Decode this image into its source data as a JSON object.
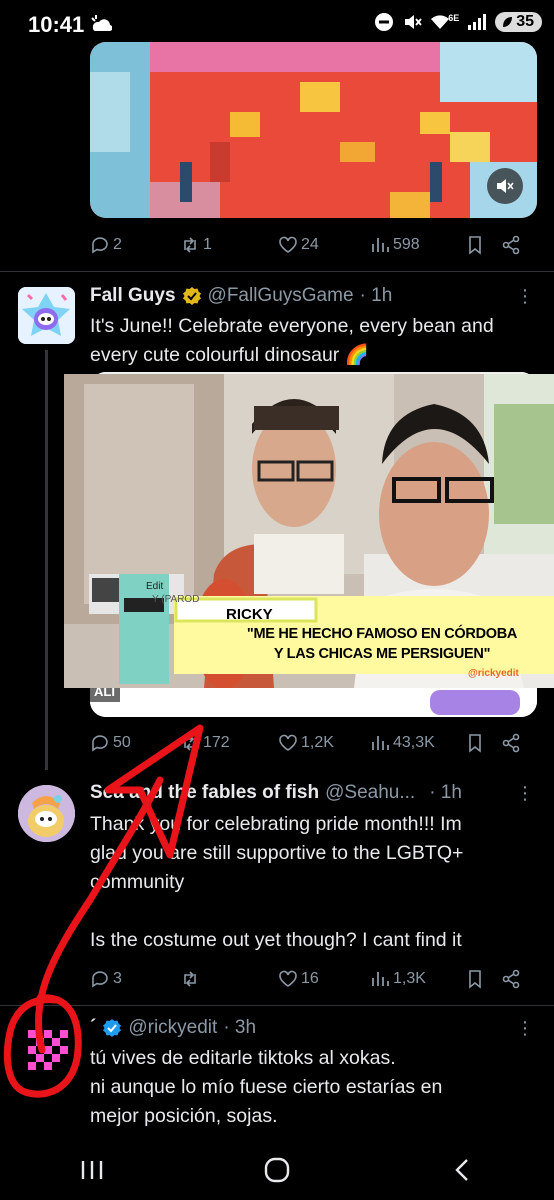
{
  "status_bar": {
    "time": "10:41",
    "network": "6E",
    "battery": "35"
  },
  "tweet0": {
    "actions": {
      "replies": "2",
      "retweets": "1",
      "likes": "24",
      "views": "598"
    }
  },
  "tweet1": {
    "name": "Fall Guys",
    "handle": "@FallGuysGame",
    "time": "· 1h",
    "text": "It's June!! Celebrate everyone, every bean and\nevery cute colourful dinosaur 🌈",
    "media": {
      "caption_name": "RICKY",
      "caption_quote_1": "\"ME HE HECHO FAMOSO EN CÓRDOBA",
      "caption_quote_2": "Y LAS CHICAS ME PERSIGUEN\"",
      "watermark": "@rickyedit",
      "small_label": "ALI",
      "overlay_edit": "Edit",
      "overlay_parod": "Y (PAROD"
    },
    "actions": {
      "replies": "50",
      "retweets": "172",
      "likes": "1,2K",
      "views": "43,3K"
    }
  },
  "tweet2": {
    "name": "Sea and the fables of fish",
    "handle": "@Seahu...",
    "time": "· 1h",
    "text": "Thank you for celebrating pride month!!! Im\nglad you are still supportive to the LGBTQ+\ncommunity\n\nIs the costume out yet though? I cant find it",
    "actions": {
      "replies": "3",
      "retweets": "",
      "likes": "16",
      "views": "1,3K"
    }
  },
  "tweet3": {
    "name": "´",
    "handle": "@rickyedit",
    "time": "· 3h",
    "text": "tú vives de editarle tiktoks al xokas.\nni aunque lo mío fuese cierto estarías en\nmejor posición, sojas."
  },
  "colors": {
    "background": "#000000",
    "text": "#e7e9ea",
    "muted": "#8b98a5",
    "verified_gold": "#e2b719",
    "verified_blue": "#1d9bf0",
    "annotation_red": "#e8141a"
  }
}
